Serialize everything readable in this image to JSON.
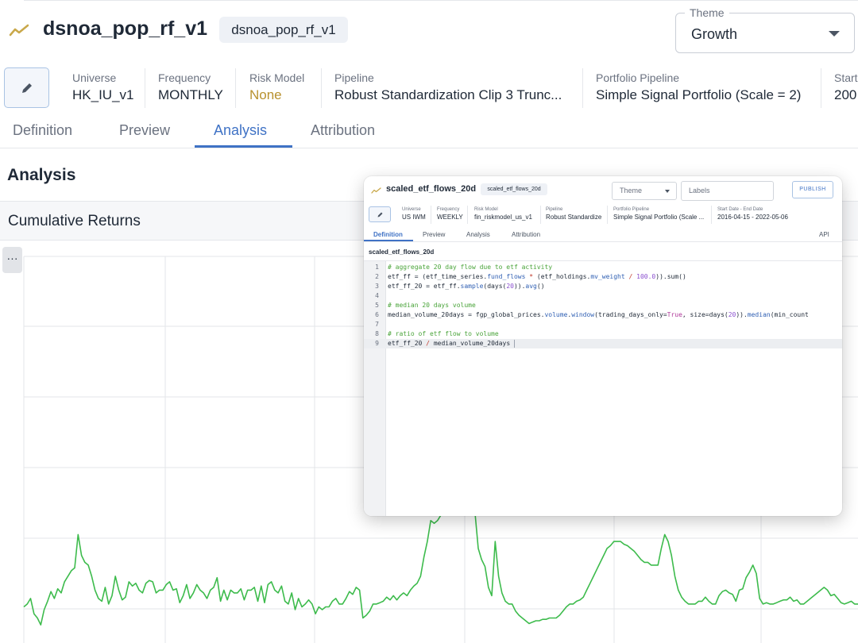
{
  "header": {
    "title": "dsnoa_pop_rf_v1",
    "chip": "dsnoa_pop_rf_v1",
    "theme_label": "Theme",
    "theme_value": "Growth"
  },
  "info": [
    {
      "label": "Universe",
      "value": "HK_IU_v1"
    },
    {
      "label": "Frequency",
      "value": "MONTHLY"
    },
    {
      "label": "Risk Model",
      "value": "None"
    },
    {
      "label": "Pipeline",
      "value": "Robust Standardization Clip 3 Trunc..."
    },
    {
      "label": "Portfolio Pipeline",
      "value": "Simple Signal Portfolio (Scale = 2)"
    },
    {
      "label": "Start",
      "value": "200"
    }
  ],
  "tabs": [
    "Definition",
    "Preview",
    "Analysis",
    "Attribution"
  ],
  "active_tab": "Analysis",
  "section_title": "Analysis",
  "card_title": "Cumulative Returns",
  "more_button": "···",
  "colors": {
    "accent": "#3f72c5",
    "line": "#3dbb4c",
    "warning": "#b8912e"
  },
  "chart_data": {
    "type": "line",
    "title": "Cumulative Returns",
    "series": [
      {
        "values": [
          -0.02,
          0.0,
          0.04,
          -0.07,
          -0.1,
          -0.15,
          -0.04,
          0.02,
          0.09,
          0.04,
          0.11,
          0.08,
          0.16,
          0.2,
          0.24,
          0.26,
          0.5,
          0.35,
          0.3,
          0.28,
          0.2,
          0.1,
          0.04,
          0.02,
          0.12,
          0.0,
          0.06,
          0.2,
          0.1,
          0.03,
          0.05,
          0.16,
          0.13,
          0.15,
          0.1,
          0.08,
          0.15,
          0.17,
          0.16,
          0.08,
          0.1,
          0.1,
          0.14,
          0.16,
          0.1,
          0.11,
          0.01,
          0.06,
          0.14,
          0.04,
          0.08,
          0.14,
          0.1,
          0.08,
          0.04,
          0.1,
          0.12,
          0.19,
          0.02,
          0.1,
          0.03,
          0.1,
          0.08,
          0.08,
          0.11,
          0.03,
          0.1,
          0.1,
          0.12,
          0.02,
          0.13,
          0.01,
          0.14,
          0.16,
          0.1,
          0.08,
          0.13,
          0.02,
          0.0,
          0.08,
          -0.04,
          0.04,
          -0.02,
          0.0,
          0.03,
          0.0,
          -0.07,
          -0.02,
          -0.04,
          -0.02,
          -0.02,
          0.02,
          0.04,
          0.0,
          0.0,
          0.04,
          0.09,
          0.07,
          0.12,
          0.1,
          -0.1,
          -0.08,
          -0.05,
          0.0,
          0.0,
          0.01,
          0.02,
          0.05,
          0.03,
          0.06,
          0.03,
          0.06,
          0.08,
          0.06,
          0.1,
          0.13,
          0.15,
          0.2,
          0.34,
          0.45,
          0.6,
          0.58,
          0.6,
          0.64,
          0.68,
          0.73,
          0.95,
          0.93,
          0.92,
          0.9,
          0.86,
          0.83,
          0.78,
          0.67,
          0.4,
          0.32,
          0.27,
          0.12,
          0.06,
          0.45,
          0.2,
          0.08,
          0.02,
          0.0,
          0.0,
          -0.05,
          -0.08,
          -0.1,
          -0.12,
          -0.14,
          -0.13,
          -0.12,
          -0.12,
          -0.11,
          -0.11,
          -0.1,
          -0.1,
          -0.1,
          -0.08,
          -0.05,
          -0.02,
          0.0,
          0.0,
          0.02,
          0.03,
          0.05,
          0.1,
          0.15,
          0.2,
          0.25,
          0.3,
          0.35,
          0.4,
          0.42,
          0.45,
          0.45,
          0.45,
          0.43,
          0.42,
          0.4,
          0.38,
          0.35,
          0.32,
          0.3,
          0.3,
          0.28,
          0.28,
          0.28,
          0.4,
          0.5,
          0.45,
          0.35,
          0.2,
          0.1,
          0.05,
          0.02,
          0.0,
          0.0,
          0.0,
          0.02,
          0.02,
          0.05,
          0.02,
          0.0,
          0.0,
          0.06,
          0.09,
          0.1,
          0.08,
          0.07,
          0.02,
          0.1,
          0.11,
          0.19,
          0.23,
          0.28,
          0.22,
          0.04,
          0.0,
          0.01,
          0.0,
          0.0,
          0.01,
          0.02,
          0.03,
          0.03,
          0.05,
          0.02,
          0.03,
          0.0,
          0.0,
          0.02,
          0.04,
          0.06,
          0.08,
          0.1,
          0.12,
          0.1,
          0.06,
          0.07,
          0.04,
          0.01,
          0.0,
          0.01,
          0.02,
          0.0,
          0.0
        ],
        "color": "#3dbb4c"
      }
    ],
    "ylim": [
      -0.28,
      2.5
    ],
    "grid": true
  },
  "overlay": {
    "title": "scaled_etf_flows_20d",
    "chip": "scaled_etf_flows_20d",
    "theme_placeholder": "Theme",
    "labels_placeholder": "Labels",
    "publish": "PUBLISH",
    "info": [
      {
        "label": "Universe",
        "value": "US IWM"
      },
      {
        "label": "Frequency",
        "value": "WEEKLY"
      },
      {
        "label": "Risk Model",
        "value": "fin_riskmodel_us_v1"
      },
      {
        "label": "Pipeline",
        "value": "Robust Standardize"
      },
      {
        "label": "Portfolio Pipeline",
        "value": "Simple Signal Portfolio (Scale ..."
      },
      {
        "label": "Start Date - End Date",
        "value": "2016-04-15 - 2022-05-06"
      }
    ],
    "tabs": [
      "Definition",
      "Preview",
      "Analysis",
      "Attribution",
      "API"
    ],
    "active_tab": "Definition",
    "definition_name": "scaled_etf_flows_20d",
    "code_lines": [
      [
        {
          "t": "# aggregate 20 day flow due to etf activity",
          "c": "c-com"
        }
      ],
      [
        {
          "t": "etf_ff = (etf_time_series."
        },
        {
          "t": "fund_flows",
          "c": "c-fn"
        },
        {
          "t": " "
        },
        {
          "t": "*",
          "c": "c-op"
        },
        {
          "t": " (etf_holdings."
        },
        {
          "t": "mv_weight",
          "c": "c-fn"
        },
        {
          "t": " "
        },
        {
          "t": "/",
          "c": "c-op"
        },
        {
          "t": " "
        },
        {
          "t": "100.0",
          "c": "c-num"
        },
        {
          "t": ")).sum()"
        }
      ],
      [
        {
          "t": "etf_ff_20 = etf_ff."
        },
        {
          "t": "sample",
          "c": "c-fn"
        },
        {
          "t": "(days("
        },
        {
          "t": "20",
          "c": "c-num"
        },
        {
          "t": "))."
        },
        {
          "t": "avg",
          "c": "c-fn"
        },
        {
          "t": "()"
        }
      ],
      [
        {
          "t": ""
        }
      ],
      [
        {
          "t": "# median 20 days volume",
          "c": "c-com"
        }
      ],
      [
        {
          "t": "median_volume_20days = fgp_global_prices."
        },
        {
          "t": "volume",
          "c": "c-fn"
        },
        {
          "t": "."
        },
        {
          "t": "window",
          "c": "c-fn"
        },
        {
          "t": "(trading_days_only="
        },
        {
          "t": "True",
          "c": "c-kw"
        },
        {
          "t": ", size=days("
        },
        {
          "t": "20",
          "c": "c-num"
        },
        {
          "t": "))."
        },
        {
          "t": "median",
          "c": "c-fn"
        },
        {
          "t": "(min_count"
        }
      ],
      [
        {
          "t": ""
        }
      ],
      [
        {
          "t": "# ratio of etf flow to volume",
          "c": "c-com"
        }
      ],
      [
        {
          "t": "etf_ff_20 "
        },
        {
          "t": "/",
          "c": "c-op"
        },
        {
          "t": " median_volume_20days "
        }
      ]
    ]
  }
}
